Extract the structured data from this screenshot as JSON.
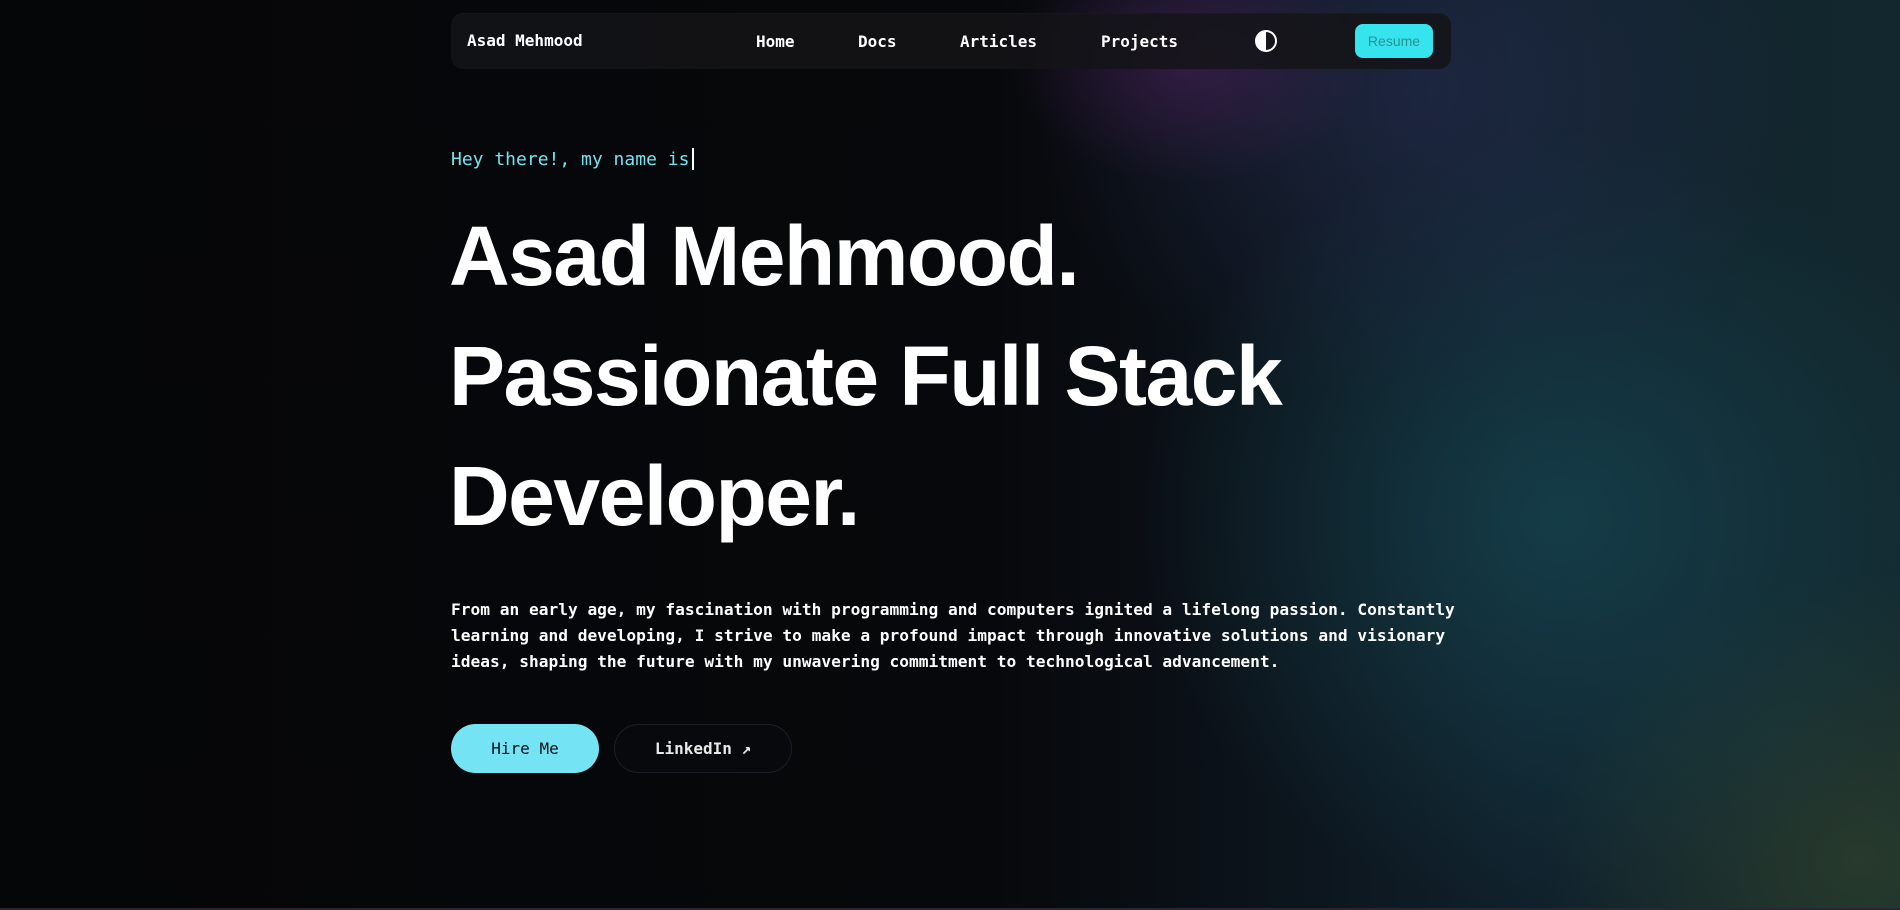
{
  "navbar": {
    "brand": "Asad Mehmood",
    "links": [
      "Home",
      "Docs",
      "Articles",
      "Projects"
    ],
    "theme_toggle_icon": "contrast-half-circle-icon",
    "resume_label": "Resume"
  },
  "hero": {
    "greeting": "Hey there!, my name is",
    "headline_lines": [
      "Asad Mehmood.",
      "Passionate Full Stack",
      "Developer."
    ],
    "bio": "From an early age, my fascination with programming and computers ignited a lifelong passion. Constantly learning and developing, I strive to make a profound impact through innovative solutions and visionary ideas, shaping the future with my unwavering commitment to technological advancement.",
    "hire_label": "Hire Me",
    "linkedin_label": "LinkedIn ↗"
  },
  "colors": {
    "accent_cyan": "#36e4ee",
    "button_cyan": "#74e4f4",
    "greeting_cyan": "#76e2ee",
    "background": "#06070a"
  }
}
